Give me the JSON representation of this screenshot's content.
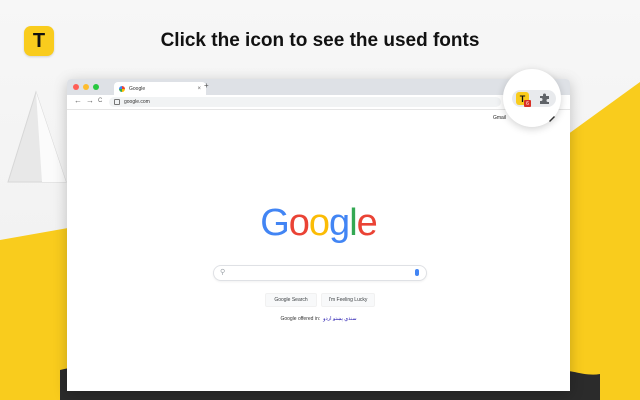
{
  "headline": "Click the icon to see the used fonts",
  "brand": {
    "letter": "T",
    "yellow": "#f9cc1d"
  },
  "browser": {
    "tab_title": "Google",
    "tab_close": "×",
    "new_tab": "+",
    "url": "google.com",
    "nav": {
      "back": "←",
      "forward": "→",
      "reload": "C"
    }
  },
  "google": {
    "gmail_link": "Gmail",
    "logo_letters": [
      {
        "ch": "G",
        "color": "#4285f4"
      },
      {
        "ch": "o",
        "color": "#ea4335"
      },
      {
        "ch": "o",
        "color": "#fbbc05"
      },
      {
        "ch": "g",
        "color": "#4285f4"
      },
      {
        "ch": "l",
        "color": "#34a853"
      },
      {
        "ch": "e",
        "color": "#ea4335"
      }
    ],
    "search_button": "Google Search",
    "lucky_button": "I'm Feeling Lucky",
    "offered_in": "Google offered in:",
    "languages": "سنڌي پښتو اردو"
  },
  "extension": {
    "letter": "T",
    "badge": "6"
  },
  "icons": [
    "t-logo-icon",
    "search-icon",
    "mic-icon",
    "lock-icon",
    "puzzle-icon",
    "pen-icon"
  ]
}
